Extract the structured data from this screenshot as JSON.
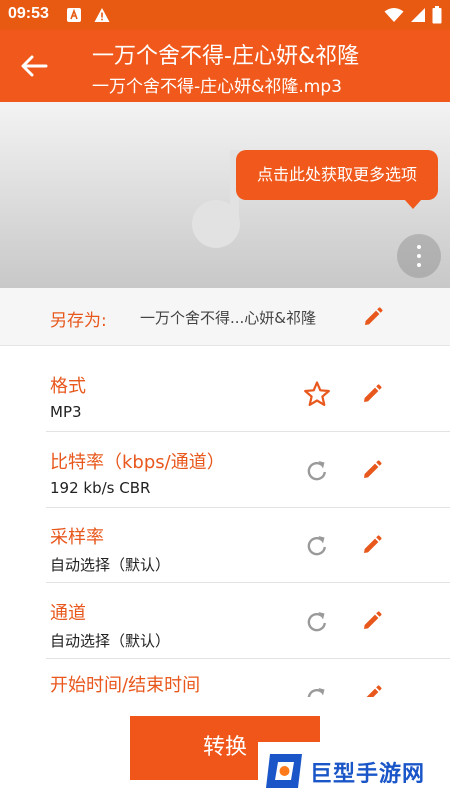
{
  "status_bar": {
    "time": "09:53",
    "notification_icons": [
      "font-icon",
      "warning-icon"
    ],
    "system_icons": [
      "wifi-icon",
      "signal-icon",
      "battery-icon"
    ]
  },
  "app_bar": {
    "title": "一万个舍不得-庄心妍&祁隆",
    "subtitle": "一万个舍不得-庄心妍&祁隆.mp3",
    "back_icon": "arrow-left-icon"
  },
  "cover": {
    "placeholder_icon": "music-note-icon",
    "tooltip": "点击此处获取更多选项",
    "more_icon": "more-vertical-icon"
  },
  "save_as": {
    "label": "另存为:",
    "value": "一万个舍不得...心妍&祁隆"
  },
  "settings": [
    {
      "title": "格式",
      "value": "MP3",
      "aux_icon": "star-outline-icon"
    },
    {
      "title": "比特率（kbps/通道）",
      "value": "192 kb/s CBR",
      "aux_icon": "reset-icon"
    },
    {
      "title": "采样率",
      "value": "自动选择（默认）",
      "aux_icon": "reset-icon"
    },
    {
      "title": "通道",
      "value": "自动选择（默认）",
      "aux_icon": "reset-icon"
    },
    {
      "title": "开始时间/结束时间",
      "value": "",
      "aux_icon": "reset-icon"
    }
  ],
  "convert_button": {
    "label": "转换"
  },
  "watermark": {
    "text": "巨型手游网"
  },
  "colors": {
    "accent": "#f0591b",
    "status_bar": "#e85a12",
    "text_accent": "#e8581d",
    "watermark_blue": "#1a56c8"
  }
}
